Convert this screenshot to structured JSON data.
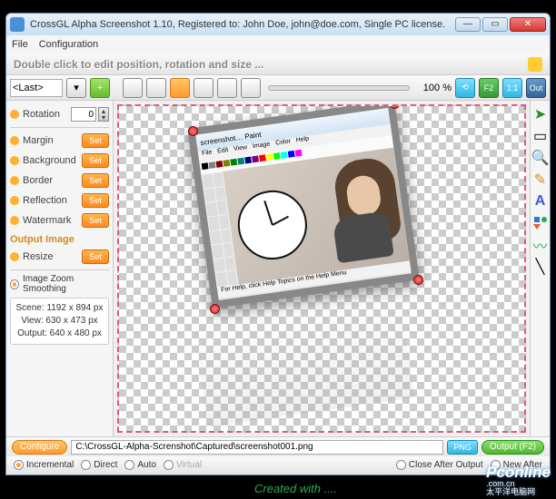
{
  "titlebar": {
    "text": "CrossGL Alpha Screenshot 1.10, Registered to: John Doe, john@doe.com, Single PC license."
  },
  "menu": {
    "file": "File",
    "config": "Configuration"
  },
  "hint": "Double click to edit position, rotation and size ...",
  "toolbar": {
    "last": "<Last>",
    "zoom_pct": "100 %",
    "f2": "F2",
    "oneone": "1:1",
    "out": "Out"
  },
  "props": {
    "rotation": {
      "label": "Rotation",
      "value": "0",
      "set": "Set"
    },
    "margin": {
      "label": "Margin",
      "set": "Set"
    },
    "background": {
      "label": "Background",
      "set": "Set"
    },
    "border": {
      "label": "Border",
      "set": "Set"
    },
    "reflection": {
      "label": "Reflection",
      "set": "Set"
    },
    "watermark": {
      "label": "Watermark",
      "set": "Set"
    },
    "output_title": "Output Image",
    "resize": {
      "label": "Resize",
      "set": "Set"
    },
    "zoom_smooth": "Image Zoom Smoothing",
    "info": {
      "scene": "Scene: 1192 x 894 px",
      "view": "View: 630 x 473 px",
      "output": "Output: 640 x 480 px"
    }
  },
  "embedded": {
    "title": "screenshot…  Paint",
    "menu": [
      "File",
      "Edit",
      "View",
      "Image",
      "Color",
      "Help"
    ],
    "status": "For Help, click Help Topics on the Help Menu"
  },
  "bottom": {
    "configure": "Configure",
    "path": "C:\\CrossGL-Alpha-Screnshot\\Captured\\screenshot001.png",
    "png": "PNG",
    "output": "Output (F2)"
  },
  "status": {
    "incremental": "Incremental",
    "direct": "Direct",
    "auto": "Auto",
    "virtual": "Virtual",
    "close_after": "Close After Output",
    "new_after": "New After"
  },
  "watermark_text": "Created with ....",
  "logo_main": "Pconline",
  "logo_small": ".com.cn",
  "logo_cn": "太平洋电脑网"
}
